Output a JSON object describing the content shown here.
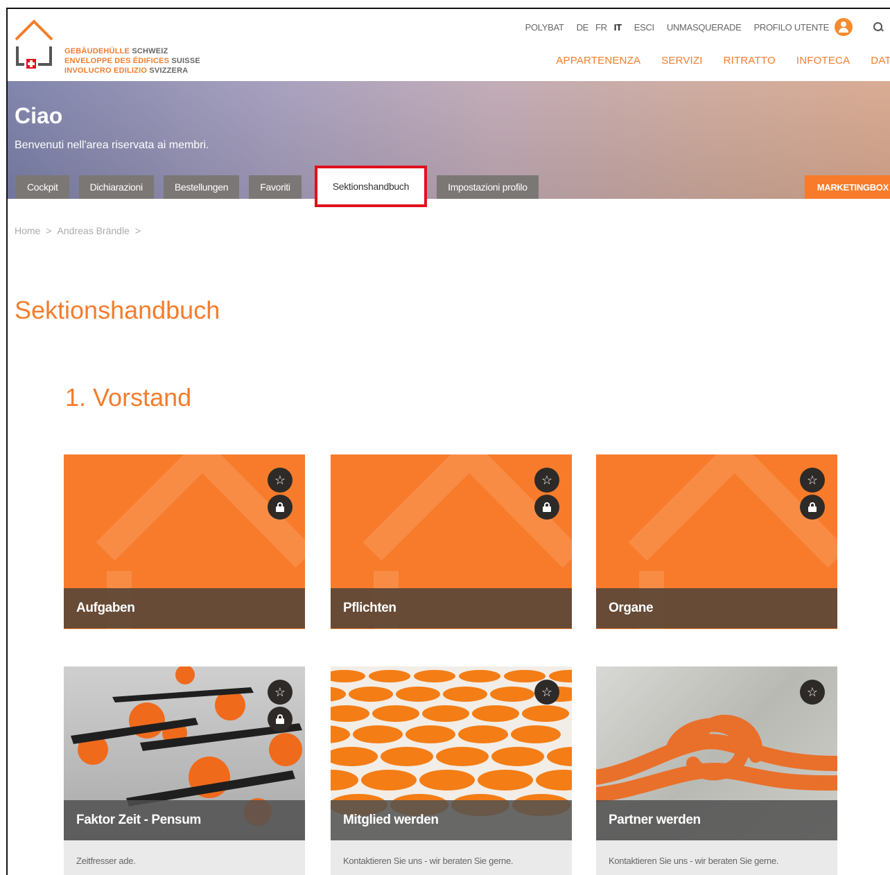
{
  "logo": {
    "line1_a": "GEBÄUDEHÜLLE",
    "line1_b": "SCHWEIZ",
    "line2_a": "ENVELOPPE DES ÉDIFICES",
    "line2_b": "SUISSE",
    "line3_a": "INVOLUCRO EDILIZIO",
    "line3_b": "SVIZZERA"
  },
  "topnav": {
    "polybat": "POLYBAT",
    "lang_de": "DE",
    "lang_fr": "FR",
    "lang_it": "IT",
    "logout": "ESCI",
    "unmasquerade": "UNMASQUERADE",
    "profile": "PROFILO UTENTE"
  },
  "mainnav": [
    "APPARTENENZA",
    "SERVIZI",
    "RITRATTO",
    "INFOTECA",
    "DATE"
  ],
  "hero": {
    "title": "Ciao",
    "subtitle": "Benvenuti nell'area riservata ai membri.",
    "tabs": [
      "Cockpit",
      "Dichiarazioni",
      "Bestellungen",
      "Favoriti",
      "Sektionshandbuch",
      "Impostazioni profilo"
    ],
    "marketingbox": "MARKETINGBOX"
  },
  "breadcrumb": [
    "Home",
    ">",
    "Andreas Brändle",
    ">"
  ],
  "page_title": "Sektionshandbuch",
  "section_title": "1. Vorstand",
  "cards": [
    {
      "title": "Aufgaben"
    },
    {
      "title": "Pflichten"
    },
    {
      "title": "Organe"
    },
    {
      "title": "Faktor Zeit - Pensum",
      "desc": "Zeitfresser ade."
    },
    {
      "title": "Mitglied werden",
      "desc": "Kontaktieren Sie uns - wir beraten Sie gerne."
    },
    {
      "title": "Partner werden",
      "desc": "Kontaktieren Sie uns - wir beraten Sie gerne."
    }
  ],
  "colors": {
    "accent": "#f47c2c",
    "card_orange": "#f77b2a",
    "highlight": "#e0111e"
  }
}
